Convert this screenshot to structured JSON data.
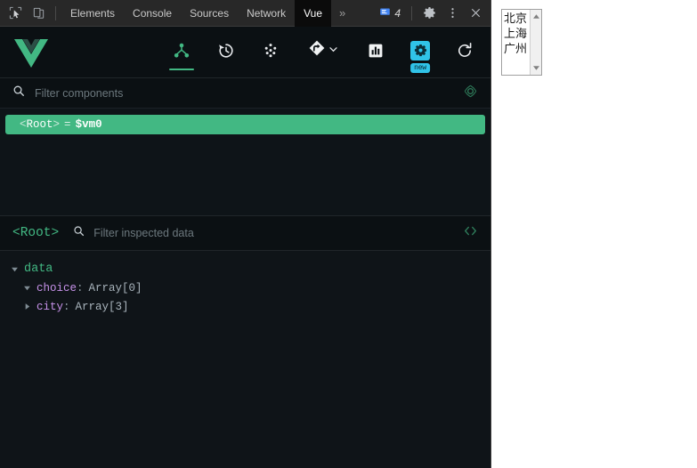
{
  "devtools": {
    "left_icons": [
      {
        "name": "inspect-element-icon",
        "label": "Inspect element"
      },
      {
        "name": "device-toolbar-icon",
        "label": "Toggle device toolbar"
      }
    ],
    "tabs": [
      {
        "id": "elements",
        "label": "Elements",
        "active": false
      },
      {
        "id": "console",
        "label": "Console",
        "active": false
      },
      {
        "id": "sources",
        "label": "Sources",
        "active": false
      },
      {
        "id": "network",
        "label": "Network",
        "active": false
      },
      {
        "id": "vue",
        "label": "Vue",
        "active": true
      }
    ],
    "overflow_label": "»",
    "message_count": "4",
    "right_icons": [
      {
        "name": "console-message-icon"
      },
      {
        "name": "gear-icon"
      },
      {
        "name": "kebab-menu-icon"
      },
      {
        "name": "close-icon"
      }
    ]
  },
  "vue_panel": {
    "logo_name": "vue-logo",
    "accent_green": "#42b883",
    "accent_cyan": "#30c3e8",
    "tools": [
      {
        "id": "components",
        "name": "components-tree-icon",
        "active": true
      },
      {
        "id": "timeline",
        "name": "timeline-history-icon",
        "active": false
      },
      {
        "id": "pinia",
        "name": "pinia-store-icon",
        "active": false
      },
      {
        "id": "routes",
        "name": "routes-icon",
        "active": false
      },
      {
        "id": "performance",
        "name": "performance-chart-icon",
        "active": false
      },
      {
        "id": "settings",
        "name": "settings-gear-icon",
        "active": false,
        "badge": "new"
      },
      {
        "id": "refresh",
        "name": "refresh-icon",
        "active": false
      }
    ],
    "filter": {
      "placeholder": "Filter components",
      "value": "",
      "search_icon": "search-icon",
      "target_icon": "select-component-target-icon"
    },
    "tree": {
      "rows": [
        {
          "open_angle": "<",
          "name": "Root",
          "close_angle": ">",
          "equals": "=",
          "instance": "$vm0",
          "selected": true
        }
      ]
    },
    "inspector": {
      "title": "<Root>",
      "filter_placeholder": "Filter inspected data",
      "filter_value": "",
      "search_icon": "search-icon",
      "code_icon": "code-brackets-icon"
    },
    "data_tree": {
      "group_label": "data",
      "group_expanded": true,
      "properties": [
        {
          "key": "choice",
          "colon": ":",
          "value": "Array[0]",
          "expanded": true
        },
        {
          "key": "city",
          "colon": ":",
          "value": "Array[3]",
          "expanded": false
        }
      ]
    }
  },
  "page": {
    "city_select": {
      "name": "city-multi-select",
      "options": [
        "北京",
        "上海",
        "广州"
      ],
      "scroll_up_icon": "scroll-up-arrow-icon",
      "scroll_down_icon": "scroll-down-arrow-icon"
    }
  }
}
